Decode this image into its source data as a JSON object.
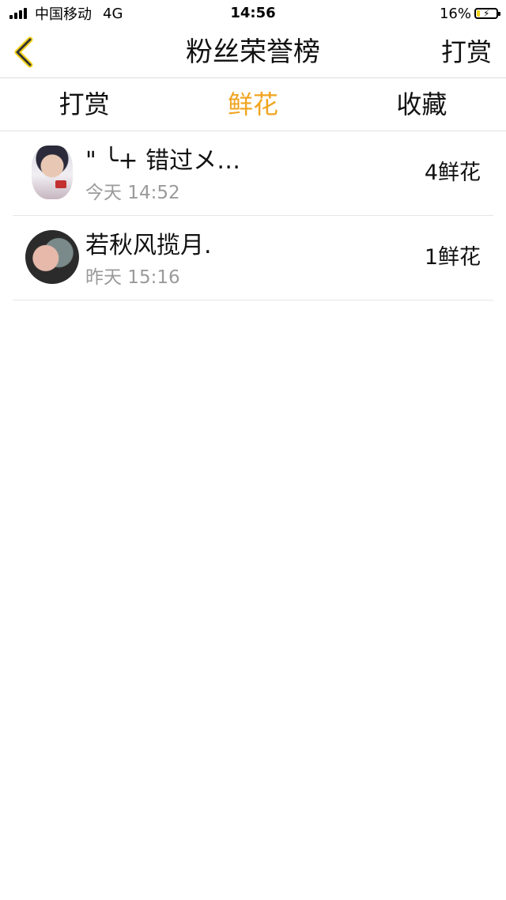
{
  "status_bar": {
    "carrier": "中国移动",
    "network": "4G",
    "time": "14:56",
    "battery_percent": "16%",
    "battery_level": 0.16
  },
  "nav": {
    "title": "粉丝荣誉榜",
    "action_label": "打赏",
    "back_icon": "chevron-left-icon"
  },
  "tabs": [
    {
      "label": "打赏",
      "active": false
    },
    {
      "label": "鲜花",
      "active": true
    },
    {
      "label": "收藏",
      "active": false
    }
  ],
  "colors": {
    "accent": "#f0a420",
    "back_icon_yellow": "#f2d21b"
  },
  "list": [
    {
      "name": "\" ╰+ 错过メ…",
      "time": "今天 14:52",
      "count": "4鲜花"
    },
    {
      "name": "若秋风揽月.",
      "time": "昨天 15:16",
      "count": "1鲜花"
    }
  ]
}
